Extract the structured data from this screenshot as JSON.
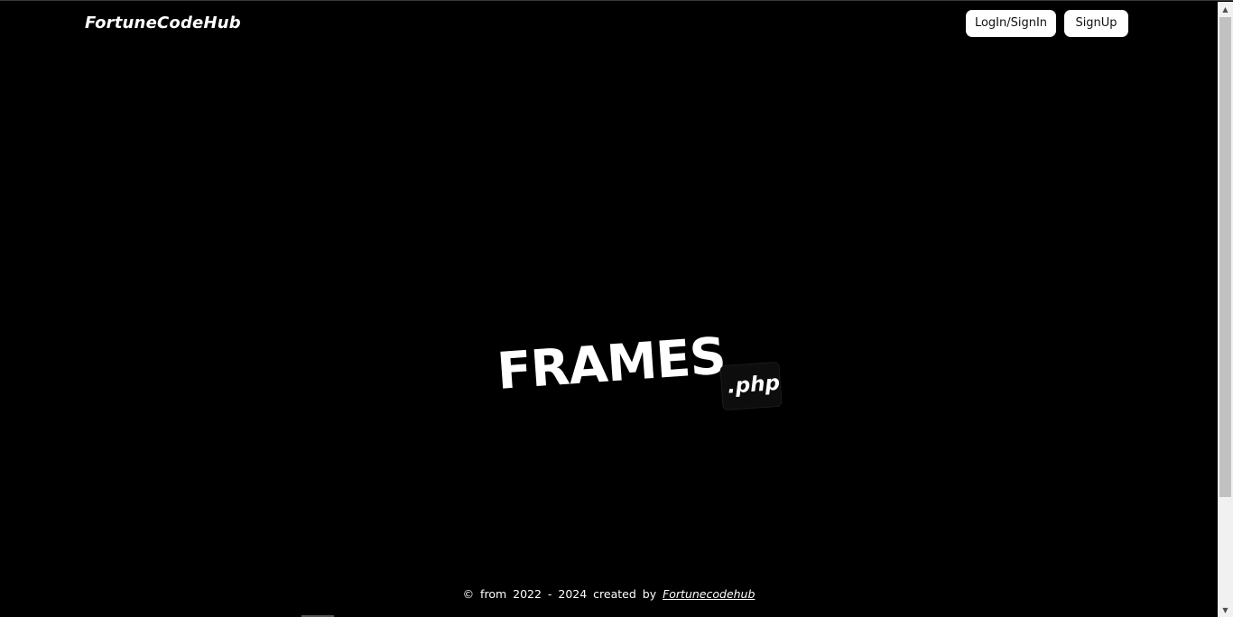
{
  "header": {
    "brand": "FortuneCodeHub",
    "login_label": "LogIn/SignIn",
    "signup_label": "SignUp"
  },
  "hero": {
    "title": "FRAMES",
    "badge": ".php"
  },
  "footer": {
    "text": "© from 2022 - 2024 created by",
    "author_link": "Fortunecodehub"
  },
  "icons": {
    "scroll_up": "chevron-up-icon",
    "scroll_down": "chevron-down-icon"
  },
  "colors": {
    "background": "#000000",
    "text": "#ffffff",
    "button_bg": "#ffffff"
  }
}
